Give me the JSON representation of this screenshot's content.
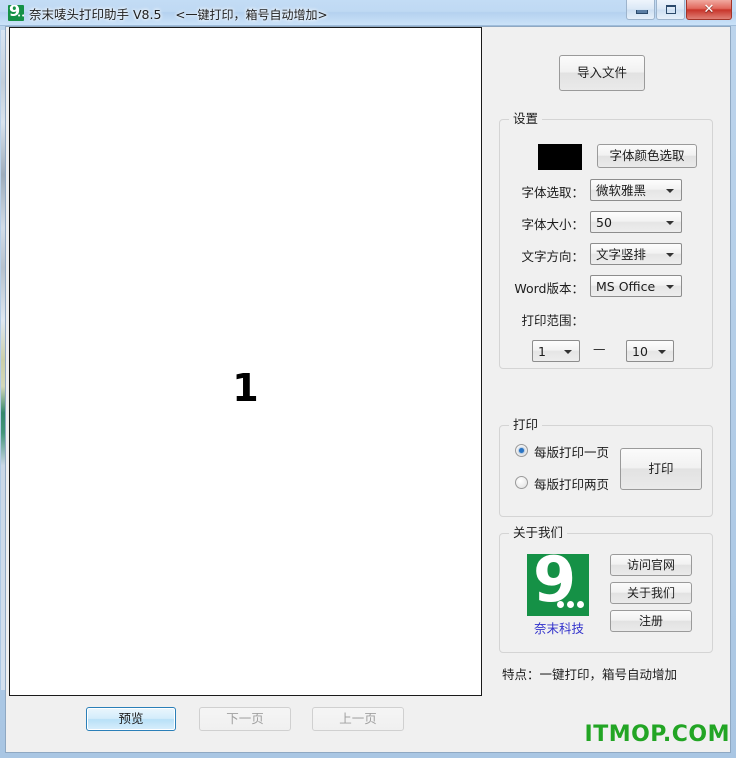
{
  "window": {
    "title": "奈末唛头打印助手 V8.5",
    "subtitle": "<一键打印，箱号自动增加>",
    "icon": "app-logo-icon",
    "controls": {
      "minimize": "minimize-icon",
      "maximize": "maximize-icon",
      "close": "✕"
    }
  },
  "preview": {
    "page_number": "1"
  },
  "bottom_bar": {
    "preview_label": "预览",
    "next_page_label": "下一页",
    "prev_page_label": "上一页"
  },
  "right_panel": {
    "import_label": "导入文件",
    "settings": {
      "title": "设置",
      "color_value": "#000000",
      "color_button_label": "字体颜色选取",
      "font_label": "字体选取：",
      "font_value": "微软雅黑",
      "size_label": "字体大小：",
      "size_value": "50",
      "direction_label": "文字方向：",
      "direction_value": "文字竖排",
      "word_label": "Word版本：",
      "word_value": "MS Office",
      "range_label": "打印范围：",
      "range_from": "1",
      "range_sep": "—",
      "range_to": "10"
    },
    "print": {
      "title": "打印",
      "option_one_label": "每版打印一页",
      "option_two_label": "每版打印两页",
      "selected": "one",
      "print_button_label": "打印"
    },
    "about": {
      "title": "关于我们",
      "logo_caption": "奈末科技",
      "logo_digit": "9",
      "visit_site_label": "访问官网",
      "about_us_label": "关于我们",
      "register_label": "注册"
    },
    "feature_text": "特点：一键打印，箱号自动增加"
  },
  "watermark": "ITMOP.COM"
}
